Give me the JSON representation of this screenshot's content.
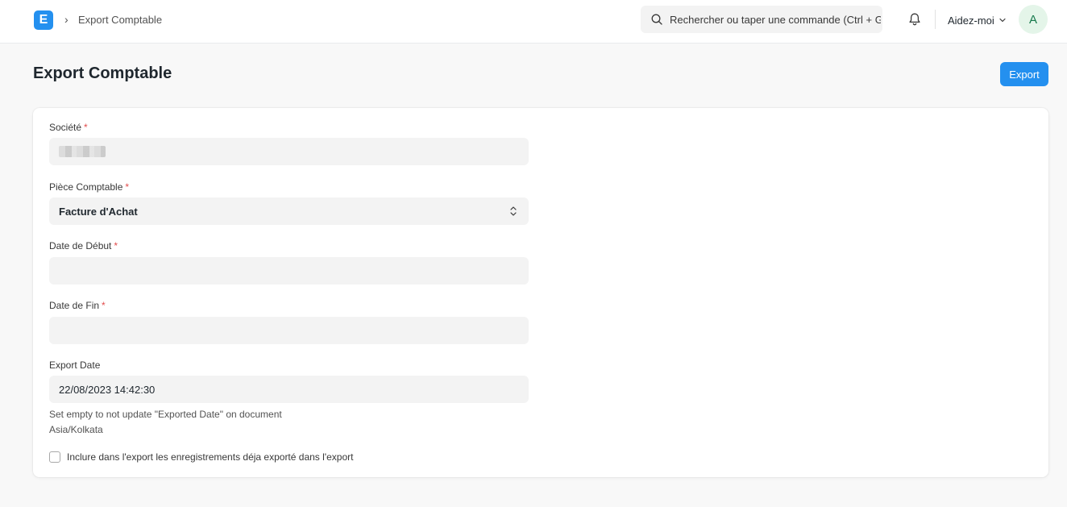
{
  "navbar": {
    "logo_letter": "E",
    "breadcrumb_separator": "›",
    "breadcrumb": "Export Comptable",
    "search_placeholder": "Rechercher ou taper une commande (Ctrl + G)",
    "help_label": "Aidez-moi",
    "avatar_initial": "A"
  },
  "page": {
    "title": "Export Comptable",
    "primary_action": "Export"
  },
  "form": {
    "company": {
      "label": "Société",
      "required": "*",
      "value": ""
    },
    "document_type": {
      "label": "Pièce Comptable",
      "required": "*",
      "value": "Facture d'Achat"
    },
    "start_date": {
      "label": "Date de Début",
      "required": "*",
      "value": ""
    },
    "end_date": {
      "label": "Date de Fin",
      "required": "*",
      "value": ""
    },
    "export_date": {
      "label": "Export Date",
      "value": "22/08/2023 14:42:30",
      "help": "Set empty to not update \"Exported Date\" on document",
      "timezone": "Asia/Kolkata"
    },
    "include_exported": {
      "label": "Inclure dans l'export les enregistrements déja exporté dans l'export",
      "checked": false
    }
  },
  "colors": {
    "accent": "#2490ef",
    "required": "#e24c4c",
    "avatar_bg": "#e4f5e9",
    "avatar_fg": "#16794c"
  },
  "icons": [
    "search-icon",
    "bell-icon",
    "chevron-down-icon",
    "select-updown-icon",
    "checkbox-icon"
  ]
}
